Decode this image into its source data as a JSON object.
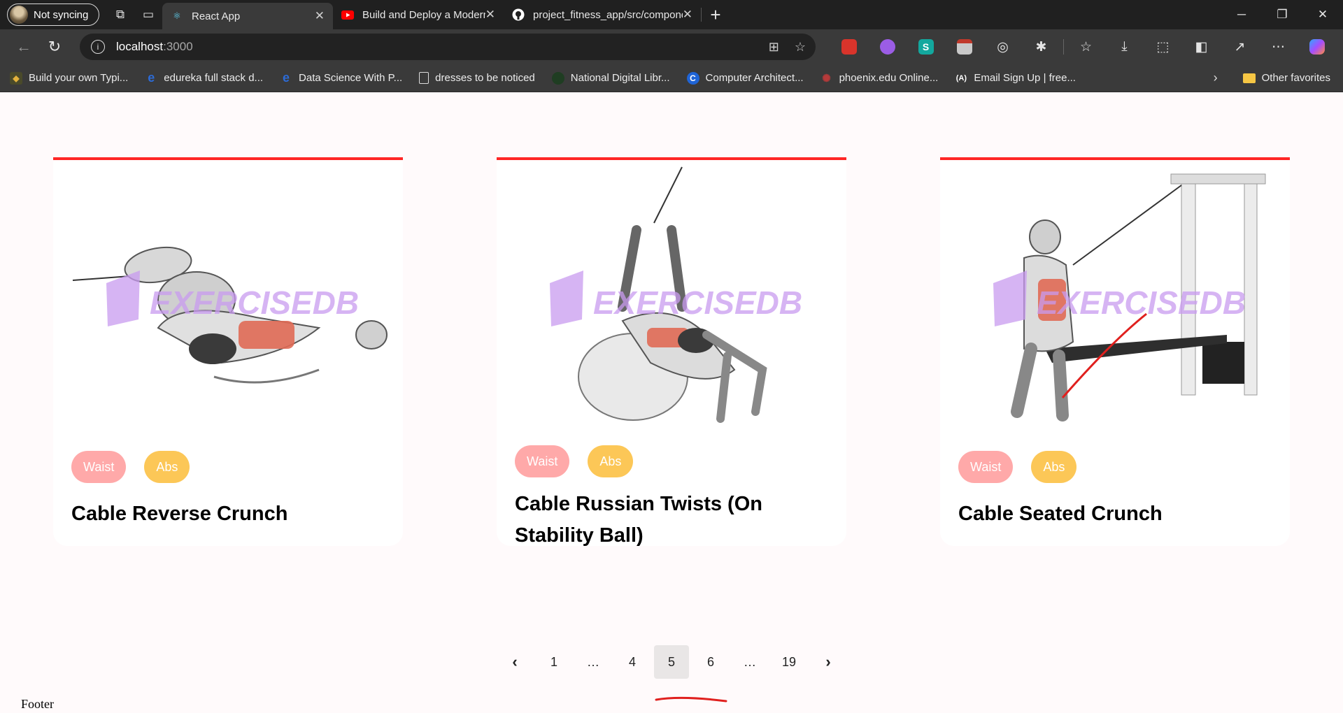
{
  "browser": {
    "profile_label": "Not syncing",
    "tabs": [
      {
        "title": "React App",
        "favicon": "react-icon"
      },
      {
        "title": "Build and Deploy a Modern React",
        "favicon": "youtube-icon"
      },
      {
        "title": "project_fitness_app/src/componen",
        "favicon": "github-icon"
      }
    ],
    "address": {
      "host": "localhost",
      "port": ":3000"
    },
    "bookmarks": [
      {
        "label": "Build your own Typi...",
        "icon": "bookmark-site-icon",
        "color": "#e3b23c"
      },
      {
        "label": "edureka full stack d...",
        "icon": "edureka-icon",
        "color": "#2c6bd6"
      },
      {
        "label": "Data Science With P...",
        "icon": "edureka-icon",
        "color": "#2c6bd6"
      },
      {
        "label": "dresses to be noticed",
        "icon": "page-icon",
        "color": "#dddddd"
      },
      {
        "label": "National Digital Libr...",
        "icon": "ndl-icon",
        "color": "#2f6b3a"
      },
      {
        "label": "Computer Architect...",
        "icon": "coursera-icon",
        "color": "#1f64d6"
      },
      {
        "label": "phoenix.edu Online...",
        "icon": "phoenix-icon",
        "color": "#b63a3a"
      },
      {
        "label": "Email Sign Up | free...",
        "icon": "angular-icon",
        "color": "#ffffff"
      }
    ],
    "other_favorites": "Other favorites"
  },
  "exercises": [
    {
      "body_part": "Waist",
      "target": "Abs",
      "name": "Cable Reverse Crunch"
    },
    {
      "body_part": "Waist",
      "target": "Abs",
      "name": "Cable Russian Twists (On Stability Ball)"
    },
    {
      "body_part": "Waist",
      "target": "Abs",
      "name": "Cable Seated Crunch"
    }
  ],
  "watermark": "EXERCISEDB",
  "pagination": {
    "prev": "‹",
    "next": "›",
    "items": [
      "1",
      "…",
      "4",
      "5",
      "6",
      "…",
      "19"
    ],
    "selected": "5"
  },
  "footer": "Footer",
  "colors": {
    "accent": "#ff2625",
    "waist_tag": "#ffa9a9",
    "abs_tag": "#fcc757",
    "watermark": "#c99bf0"
  }
}
